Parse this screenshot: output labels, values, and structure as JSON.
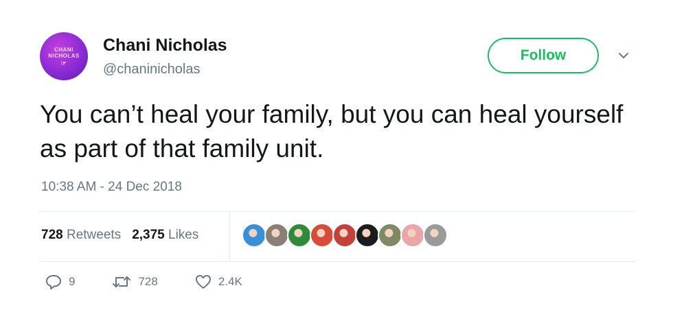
{
  "tweet": {
    "author": {
      "name": "Chani Nicholas",
      "handle": "@chaninicholas",
      "avatar_text_line1": "CHANI",
      "avatar_text_line2": "NICHOLAS",
      "avatar_color": "#8b2bd6"
    },
    "follow_label": "Follow",
    "text": "You can’t heal your family, but you can heal yourself as part of that family unit.",
    "timestamp": "10:38 AM - 24 Dec 2018",
    "stats": {
      "retweets_count": "728",
      "retweets_label": "Retweets",
      "likes_count": "2,375",
      "likes_label": "Likes"
    },
    "liker_avatars": [
      {
        "name": "liker-avatar-1",
        "color": "#3a8fd9"
      },
      {
        "name": "liker-avatar-2",
        "color": "#8a7f74"
      },
      {
        "name": "liker-avatar-3",
        "color": "#2f8a3a"
      },
      {
        "name": "liker-avatar-4",
        "color": "#d84a3a"
      },
      {
        "name": "liker-avatar-5",
        "color": "#c2413a"
      },
      {
        "name": "liker-avatar-6",
        "color": "#1c1c1c"
      },
      {
        "name": "liker-avatar-7",
        "color": "#7d8a63"
      },
      {
        "name": "liker-avatar-8",
        "color": "#e9a5a8"
      },
      {
        "name": "liker-avatar-9",
        "color": "#9a9a9a"
      }
    ],
    "actions": {
      "replies": "9",
      "retweets": "728",
      "likes": "2.4K"
    },
    "accent_color": "#17bf63",
    "muted_color": "#657786"
  }
}
